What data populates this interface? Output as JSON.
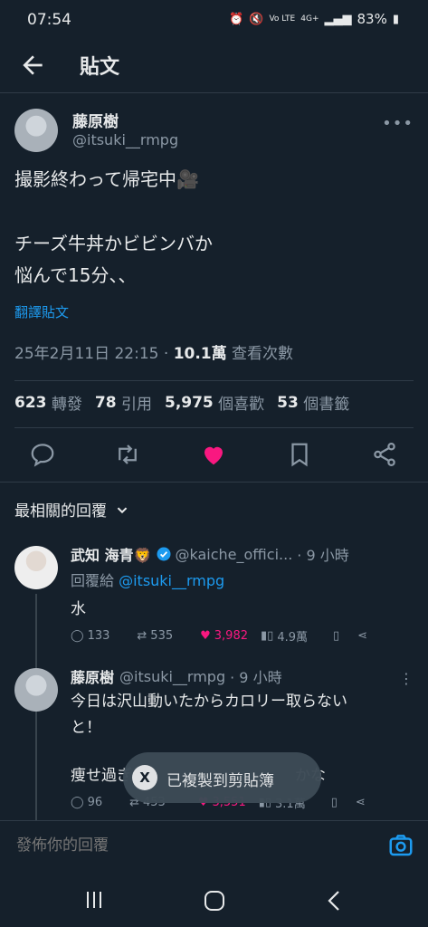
{
  "status": {
    "time": "07:54",
    "battery": "83%"
  },
  "header": {
    "title": "貼文"
  },
  "post": {
    "name": "藤原樹",
    "handle": "@itsuki__rmpg",
    "lines": [
      "撮影終わって帰宅中🎥",
      "チーズ牛丼かビビンバか",
      "悩んで15分、、"
    ],
    "translate": "翻譯貼文",
    "datetime": "25年2月11日 22:15 · ",
    "views": "10.1萬",
    "views_label": " 查看次數"
  },
  "stats": [
    {
      "n": "623",
      "label": "轉發"
    },
    {
      "n": "78",
      "label": "引用"
    },
    {
      "n": "5,975",
      "label": "個喜歡"
    },
    {
      "n": "53",
      "label": "個書籤"
    }
  ],
  "sort_label": "最相關的回覆",
  "reply1": {
    "name": "武知 海青🦁",
    "handle": "@kaiche_offici...",
    "time": "· 9 小時",
    "reply_to_prefix": "回覆給 ",
    "reply_to": "@itsuki__rmpg",
    "text": "水",
    "replies": "133",
    "reposts": "535",
    "likes": "3,982",
    "views": "4.9萬"
  },
  "reply2": {
    "name": "藤原樹",
    "handle": "@itsuki__rmpg",
    "time": "· 9 小時",
    "line1": "今日は沢山動いたからカロリー取らない",
    "line2": "と！",
    "line3": "痩せ過ぎ",
    "line3_tail": "かな",
    "replies": "96",
    "reposts": "453",
    "likes": "3,551",
    "views": "3.1萬"
  },
  "toast": {
    "text": "已複製到剪貼簿",
    "icon": "X"
  },
  "compose": {
    "placeholder": "發佈你的回覆"
  },
  "colors": {
    "accent": "#1d9bf0",
    "like": "#f91880",
    "bg": "#15202b"
  }
}
